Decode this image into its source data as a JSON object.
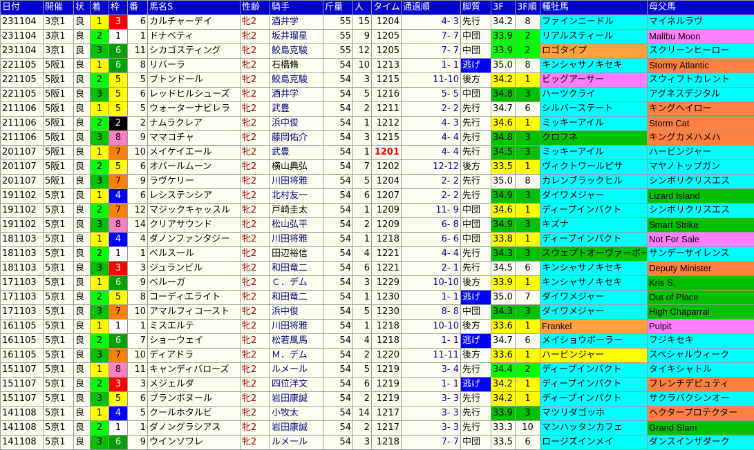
{
  "headers": [
    "日付",
    "開催",
    "状",
    "着",
    "枠",
    "番",
    "馬名S",
    "性齢",
    "騎手",
    "斤量",
    "人",
    "タイム",
    "通過順",
    "脚質",
    "3F",
    "3F順",
    "種牡馬",
    "母父馬"
  ],
  "frame_colors": {
    "1": "#ffffff",
    "2": "#000000",
    "3": "#ff0000",
    "4": "#0000ff",
    "5": "#ffff00",
    "6": "#00a000",
    "7": "#ff8000",
    "8": "#ff80c0"
  },
  "finish_colors": {
    "1": "#ffff00",
    "2": "#00ff00",
    "3": "#00c000"
  },
  "sire_colors": {
    "cyan": "#00ffff",
    "gold": "#ffa040",
    "green": "#00ff00",
    "magenta": "#ff80ff",
    "darkgreen": "#00c000",
    "orange": "#ff8040",
    "yellow": "#ffff00"
  },
  "rows": [
    {
      "date": "231104",
      "meet": "3京1",
      "cond": "良",
      "fin": "1",
      "frame": "3",
      "num": "6",
      "horse": "カルチャーデイ",
      "sexage": "牝2",
      "jockey": "酒井学",
      "wt": "55",
      "pop": "15",
      "time": "1204",
      "pass": "4- 3",
      "style": "先行",
      "f3": "34.2",
      "f3r": "8",
      "sire": "ファインニードル",
      "sire_bg": "cyan",
      "dam_sire": "マイネルラヴ",
      "dam_bg": "cyan"
    },
    {
      "date": "231104",
      "meet": "3京1",
      "cond": "良",
      "fin": "2",
      "frame": "1",
      "num": "1",
      "horse": "ドナベティ",
      "sexage": "牝2",
      "jockey": "坂井瑠星",
      "wt": "55",
      "pop": "9",
      "time": "1205",
      "pass": "7- 7",
      "style": "中団",
      "f3": "33.9",
      "f3r": "2",
      "sire": "リアルスティール",
      "sire_bg": "cyan",
      "dam_sire": "Malibu Moon",
      "dam_bg": "magenta"
    },
    {
      "date": "231104",
      "meet": "3京1",
      "cond": "良",
      "fin": "3",
      "frame": "6",
      "num": "11",
      "horse": "シカゴスティング",
      "sexage": "牝2",
      "jockey": "鮫島克駿",
      "wt": "55",
      "pop": "12",
      "time": "1205",
      "pass": "7- 7",
      "style": "中団",
      "f3": "33.9",
      "f3r": "2",
      "sire": "ロゴタイプ",
      "sire_bg": "gold",
      "dam_sire": "スクリーンヒーロー",
      "dam_bg": "cyan"
    },
    {
      "date": "221105",
      "meet": "5阪1",
      "cond": "良",
      "fin": "1",
      "frame": "6",
      "num": "8",
      "horse": "リバーラ",
      "sexage": "牝2",
      "jockey": "石橋脩",
      "wt": "54",
      "pop": "10",
      "time": "1213",
      "pass": "1- 1",
      "style": "逃げ",
      "f3": "35.0",
      "f3r": "8",
      "sire": "キンシャサノキセキ",
      "sire_bg": "cyan",
      "dam_sire": "Stormy Atlantic",
      "dam_bg": "orange"
    },
    {
      "date": "221105",
      "meet": "5阪1",
      "cond": "良",
      "fin": "2",
      "frame": "5",
      "num": "5",
      "horse": "ブトンドール",
      "sexage": "牝2",
      "jockey": "鮫島克駿",
      "wt": "54",
      "pop": "3",
      "time": "1215",
      "pass": "11-10",
      "style": "後方",
      "f3": "34.2",
      "f3r": "1",
      "sire": "ビッグアーサー",
      "sire_bg": "magenta",
      "dam_sire": "スウィフトカレント",
      "dam_bg": "cyan"
    },
    {
      "date": "221105",
      "meet": "5阪1",
      "cond": "良",
      "fin": "3",
      "frame": "5",
      "num": "6",
      "horse": "レッドヒルシューズ",
      "sexage": "牝2",
      "jockey": "酒井学",
      "wt": "54",
      "pop": "5",
      "time": "1216",
      "pass": "5- 5",
      "style": "中団",
      "f3": "34.8",
      "f3r": "3",
      "sire": "ハーツクライ",
      "sire_bg": "cyan",
      "dam_sire": "アグネスデジタル",
      "dam_bg": "cyan"
    },
    {
      "date": "211106",
      "meet": "5阪1",
      "cond": "良",
      "fin": "1",
      "frame": "5",
      "num": "5",
      "horse": "ウォーターナビレラ",
      "sexage": "牝2",
      "jockey": "武豊",
      "wt": "54",
      "pop": "2",
      "time": "1211",
      "pass": "2- 2",
      "style": "先行",
      "f3": "34.7",
      "f3r": "6",
      "sire": "シルバーステート",
      "sire_bg": "cyan",
      "dam_sire": "キングヘイロー",
      "dam_bg": "orange"
    },
    {
      "date": "211106",
      "meet": "5阪1",
      "cond": "良",
      "fin": "2",
      "frame": "2",
      "num": "2",
      "horse": "ナムラクレア",
      "sexage": "牝2",
      "jockey": "浜中俊",
      "wt": "54",
      "pop": "1",
      "time": "1212",
      "pass": "4- 3",
      "style": "先行",
      "f3": "34.6",
      "f3r": "1",
      "sire": "ミッキーアイル",
      "sire_bg": "cyan",
      "dam_sire": "Storm Cat",
      "dam_bg": "orange"
    },
    {
      "date": "211106",
      "meet": "5阪1",
      "cond": "良",
      "fin": "3",
      "frame": "8",
      "num": "9",
      "horse": "ママコチャ",
      "sexage": "牝2",
      "jockey": "藤岡佑介",
      "wt": "54",
      "pop": "3",
      "time": "1215",
      "pass": "4- 4",
      "style": "先行",
      "f3": "34.8",
      "f3r": "3",
      "sire": "クロフネ",
      "sire_bg": "darkgreen",
      "dam_sire": "キングカメハメハ",
      "dam_bg": "orange"
    },
    {
      "date": "201107",
      "meet": "5阪1",
      "cond": "良",
      "fin": "1",
      "frame": "7",
      "num": "10",
      "horse": "メイケイエール",
      "sexage": "牝2",
      "jockey": "武豊",
      "wt": "54",
      "pop": "1",
      "time": "1201",
      "pass": "4- 4",
      "style": "先行",
      "f3": "34.5",
      "f3r": "3",
      "sire": "ミッキーアイル",
      "sire_bg": "cyan",
      "dam_sire": "ハービンジャー",
      "dam_bg": "cyan",
      "fast": true
    },
    {
      "date": "201107",
      "meet": "5阪1",
      "cond": "良",
      "fin": "2",
      "frame": "5",
      "num": "6",
      "horse": "オパールムーン",
      "sexage": "牝2",
      "jockey": "横山典弘",
      "wt": "54",
      "pop": "7",
      "time": "1202",
      "pass": "12-12",
      "style": "後方",
      "f3": "33.5",
      "f3r": "1",
      "sire": "ヴィクトワールピサ",
      "sire_bg": "cyan",
      "dam_sire": "マヤノトップガン",
      "dam_bg": "cyan"
    },
    {
      "date": "201107",
      "meet": "5阪1",
      "cond": "良",
      "fin": "3",
      "frame": "7",
      "num": "9",
      "horse": "ラヴケリー",
      "sexage": "牝2",
      "jockey": "川田将雅",
      "wt": "54",
      "pop": "5",
      "time": "1204",
      "pass": "2- 2",
      "style": "先行",
      "f3": "35.0",
      "f3r": "8",
      "sire": "カレンブラックヒル",
      "sire_bg": "cyan",
      "dam_sire": "シンボリクリスエス",
      "dam_bg": "cyan"
    },
    {
      "date": "191102",
      "meet": "5京1",
      "cond": "良",
      "fin": "1",
      "frame": "4",
      "num": "6",
      "horse": "レシステンシア",
      "sexage": "牝2",
      "jockey": "北村友一",
      "wt": "54",
      "pop": "6",
      "time": "1207",
      "pass": "2- 2",
      "style": "先行",
      "f3": "34.9",
      "f3r": "3",
      "sire": "ダイワメジャー",
      "sire_bg": "cyan",
      "dam_sire": "Lizard Island",
      "dam_bg": "darkgreen"
    },
    {
      "date": "191102",
      "meet": "5京1",
      "cond": "良",
      "fin": "2",
      "frame": "7",
      "num": "12",
      "horse": "マジックキャッスル",
      "sexage": "牝2",
      "jockey": "戸崎圭太",
      "wt": "54",
      "pop": "1",
      "time": "1209",
      "pass": "11- 9",
      "style": "中団",
      "f3": "34.6",
      "f3r": "1",
      "sire": "ディープインパクト",
      "sire_bg": "cyan",
      "dam_sire": "シンボリクリスエス",
      "dam_bg": "cyan"
    },
    {
      "date": "191102",
      "meet": "5京1",
      "cond": "良",
      "fin": "3",
      "frame": "8",
      "num": "14",
      "horse": "クリアサウンド",
      "sexage": "牝2",
      "jockey": "松山弘平",
      "wt": "54",
      "pop": "2",
      "time": "1209",
      "pass": "6- 8",
      "style": "中団",
      "f3": "34.9",
      "f3r": "3",
      "sire": "キズナ",
      "sire_bg": "cyan",
      "dam_sire": "Smart Strike",
      "dam_bg": "darkgreen"
    },
    {
      "date": "181103",
      "meet": "5京1",
      "cond": "良",
      "fin": "1",
      "frame": "4",
      "num": "4",
      "horse": "ダノンファンタジー",
      "sexage": "牝2",
      "jockey": "川田将雅",
      "wt": "54",
      "pop": "1",
      "time": "1218",
      "pass": "6- 6",
      "style": "中団",
      "f3": "33.8",
      "f3r": "1",
      "sire": "ディープインパクト",
      "sire_bg": "cyan",
      "dam_sire": "Not For Sale",
      "dam_bg": "magenta"
    },
    {
      "date": "181103",
      "meet": "5京1",
      "cond": "良",
      "fin": "2",
      "frame": "1",
      "num": "1",
      "horse": "ベルスール",
      "sexage": "牝2",
      "jockey": "田辺裕信",
      "wt": "54",
      "pop": "4",
      "time": "1221",
      "pass": "4- 4",
      "style": "先行",
      "f3": "34.3",
      "f3r": "3",
      "sire": "スウェプトオーヴァーボード",
      "sire_bg": "darkgreen",
      "dam_sire": "サンデーサイレンス",
      "dam_bg": "cyan"
    },
    {
      "date": "181103",
      "meet": "5京1",
      "cond": "良",
      "fin": "3",
      "frame": "3",
      "num": "3",
      "horse": "ジュランビル",
      "sexage": "牝2",
      "jockey": "和田竜二",
      "wt": "54",
      "pop": "6",
      "time": "1221",
      "pass": "2- 1",
      "style": "先行",
      "f3": "34.5",
      "f3r": "6",
      "sire": "キンシャサノキセキ",
      "sire_bg": "cyan",
      "dam_sire": "Deputy Minister",
      "dam_bg": "orange"
    },
    {
      "date": "171103",
      "meet": "5京1",
      "cond": "良",
      "fin": "1",
      "frame": "6",
      "num": "9",
      "horse": "ベルーガ",
      "sexage": "牝2",
      "jockey": "Ｃ．デム",
      "wt": "54",
      "pop": "3",
      "time": "1229",
      "pass": "10-10",
      "style": "後方",
      "f3": "33.9",
      "f3r": "1",
      "sire": "キンシャサノキセキ",
      "sire_bg": "cyan",
      "dam_sire": "Kris S.",
      "dam_bg": "darkgreen"
    },
    {
      "date": "171103",
      "meet": "5京1",
      "cond": "良",
      "fin": "2",
      "frame": "5",
      "num": "8",
      "horse": "コーディエライト",
      "sexage": "牝2",
      "jockey": "和田竜二",
      "wt": "54",
      "pop": "1",
      "time": "1230",
      "pass": "1- 1",
      "style": "逃げ",
      "f3": "35.0",
      "f3r": "7",
      "sire": "ダイワメジャー",
      "sire_bg": "cyan",
      "dam_sire": "Out of Place",
      "dam_bg": "darkgreen"
    },
    {
      "date": "171103",
      "meet": "5京1",
      "cond": "良",
      "fin": "3",
      "frame": "7",
      "num": "10",
      "horse": "アマルフィコースト",
      "sexage": "牝2",
      "jockey": "浜中俊",
      "wt": "54",
      "pop": "5",
      "time": "1230",
      "pass": "8- 8",
      "style": "中団",
      "f3": "34.3",
      "f3r": "3",
      "sire": "ダイワメジャー",
      "sire_bg": "cyan",
      "dam_sire": "High Chaparral",
      "dam_bg": "darkgreen"
    },
    {
      "date": "161105",
      "meet": "5京1",
      "cond": "良",
      "fin": "1",
      "frame": "1",
      "num": "1",
      "horse": "ミスエルテ",
      "sexage": "牝2",
      "jockey": "川田将雅",
      "wt": "54",
      "pop": "1",
      "time": "1218",
      "pass": "10-10",
      "style": "後方",
      "f3": "33.6",
      "f3r": "1",
      "sire": "Frankel",
      "sire_bg": "gold",
      "dam_sire": "Pulpit",
      "dam_bg": "magenta"
    },
    {
      "date": "161105",
      "meet": "5京1",
      "cond": "良",
      "fin": "2",
      "frame": "6",
      "num": "7",
      "horse": "ショーウェイ",
      "sexage": "牝2",
      "jockey": "松若風馬",
      "wt": "54",
      "pop": "4",
      "time": "1218",
      "pass": "1- 1",
      "style": "逃げ",
      "f3": "34.7",
      "f3r": "6",
      "sire": "メイショウボーラー",
      "sire_bg": "cyan",
      "dam_sire": "フジキセキ",
      "dam_bg": "cyan"
    },
    {
      "date": "161105",
      "meet": "5京1",
      "cond": "良",
      "fin": "3",
      "frame": "7",
      "num": "10",
      "horse": "ディアドラ",
      "sexage": "牝2",
      "jockey": "Ｍ．デム",
      "wt": "54",
      "pop": "2",
      "time": "1220",
      "pass": "11-11",
      "style": "後方",
      "f3": "33.6",
      "f3r": "1",
      "sire": "ハービンジャー",
      "sire_bg": "yellow",
      "dam_sire": "スペシャルウィーク",
      "dam_bg": "cyan"
    },
    {
      "date": "151107",
      "meet": "5京1",
      "cond": "良",
      "fin": "1",
      "frame": "8",
      "num": "11",
      "horse": "キャンディバローズ",
      "sexage": "牝2",
      "jockey": "ルメール",
      "wt": "54",
      "pop": "5",
      "time": "1219",
      "pass": "3- 4",
      "style": "先行",
      "f3": "34.4",
      "f3r": "2",
      "sire": "ディープインパクト",
      "sire_bg": "cyan",
      "dam_sire": "タイキシャトル",
      "dam_bg": "cyan"
    },
    {
      "date": "151107",
      "meet": "5京1",
      "cond": "良",
      "fin": "2",
      "frame": "3",
      "num": "3",
      "horse": "メジェルダ",
      "sexage": "牝2",
      "jockey": "四位洋文",
      "wt": "54",
      "pop": "6",
      "time": "1219",
      "pass": "1- 1",
      "style": "逃げ",
      "f3": "34.2",
      "f3r": "1",
      "sire": "ディープインパクト",
      "sire_bg": "cyan",
      "dam_sire": "フレンチデピュティ",
      "dam_bg": "orange"
    },
    {
      "date": "151107",
      "meet": "5京1",
      "cond": "良",
      "fin": "3",
      "frame": "5",
      "num": "6",
      "horse": "ブランボヌール",
      "sexage": "牝2",
      "jockey": "岩田康誠",
      "wt": "54",
      "pop": "2",
      "time": "1219",
      "pass": "3- 3",
      "style": "先行",
      "f3": "34.2",
      "f3r": "1",
      "sire": "ディープインパクト",
      "sire_bg": "cyan",
      "dam_sire": "サクラバクシンオー",
      "dam_bg": "cyan"
    },
    {
      "date": "141108",
      "meet": "5京1",
      "cond": "良",
      "fin": "1",
      "frame": "4",
      "num": "5",
      "horse": "クールホタルビ",
      "sexage": "牝2",
      "jockey": "小牧太",
      "wt": "54",
      "pop": "14",
      "time": "1217",
      "pass": "3- 3",
      "style": "先行",
      "f3": "33.9",
      "f3r": "3",
      "sire": "マツリダゴッホ",
      "sire_bg": "cyan",
      "dam_sire": "ヘクタープロテクター",
      "dam_bg": "orange"
    },
    {
      "date": "141108",
      "meet": "5京1",
      "cond": "良",
      "fin": "2",
      "frame": "1",
      "num": "1",
      "horse": "ダノングラシアス",
      "sexage": "牝2",
      "jockey": "岩田康誠",
      "wt": "54",
      "pop": "2",
      "time": "1217",
      "pass": "3- 3",
      "style": "先行",
      "f3": "33.3",
      "f3r": "10",
      "sire": "マンハッタンカフェ",
      "sire_bg": "cyan",
      "dam_sire": "Grand Slam",
      "dam_bg": "darkgreen"
    },
    {
      "date": "141108",
      "meet": "5京1",
      "cond": "良",
      "fin": "3",
      "frame": "6",
      "num": "9",
      "horse": "ウインソワレ",
      "sexage": "牝2",
      "jockey": "ルメール",
      "wt": "54",
      "pop": "3",
      "time": "1218",
      "pass": "7- 7",
      "style": "中団",
      "f3": "33.5",
      "f3r": "6",
      "sire": "ロージズインメイ",
      "sire_bg": "cyan",
      "dam_sire": "ダンスインザダーク",
      "dam_bg": "cyan"
    }
  ]
}
